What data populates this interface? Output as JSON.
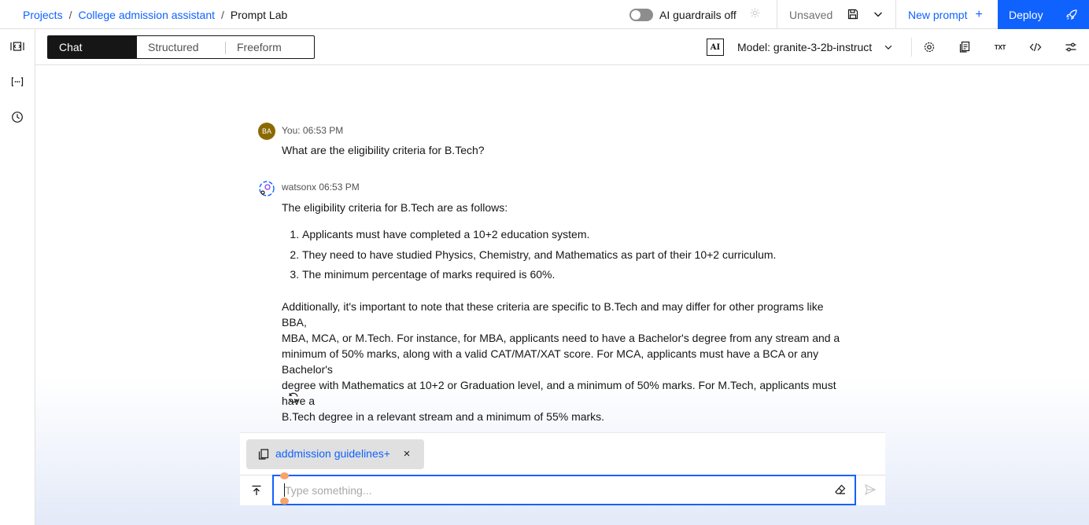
{
  "breadcrumb": {
    "projects": "Projects",
    "sep1": "/",
    "project": "College admission assistant",
    "sep2": "/",
    "current": "Prompt Lab"
  },
  "header": {
    "guardrails_label": "AI guardrails off",
    "guardrails_on": false,
    "unsaved_label": "Unsaved",
    "new_prompt_label": "New prompt",
    "new_prompt_plus": "+",
    "deploy_label": "Deploy"
  },
  "modes": {
    "chat": "Chat",
    "structured": "Structured",
    "freeform": "Freeform",
    "active": "Chat"
  },
  "model": {
    "badge": "AI",
    "label": "Model: granite-3-2b-instruct",
    "toolbar_txt": "TXT"
  },
  "conversation": {
    "user": {
      "avatar_initials": "BA",
      "meta": "You: 06:53 PM",
      "text": "What are the eligibility criteria for B.Tech?"
    },
    "assistant": {
      "meta": "watsonx 06:53 PM",
      "intro": "The eligibility criteria for B.Tech are as follows:",
      "items": [
        "Applicants must have completed a 10+2 education system.",
        "They need to have studied Physics, Chemistry, and Mathematics as part of their 10+2 curriculum.",
        "The minimum percentage of marks required is 60%."
      ],
      "paragraph_lines": [
        "Additionally, it's important to note that these criteria are specific to B.Tech and may differ for other programs like BBA,",
        "MBA, MCA, or M.Tech. For instance, for MBA, applicants need to have a Bachelor's degree from any stream and a",
        "minimum of 50% marks, along with a valid CAT/MAT/XAT score. For MCA, applicants must have a BCA or any Bachelor's",
        "degree with Mathematics at 10+2 or Graduation level, and a minimum of 50% marks. For M.Tech, applicants must have a",
        "B.Tech degree in a relevant stream and a minimum of 55% marks."
      ]
    }
  },
  "composer": {
    "attachment_name": "addmission guidelines+",
    "attachment_close": "×",
    "input_value": "",
    "placeholder": "Type something..."
  },
  "colors": {
    "accent": "#0f62fe",
    "user_avatar": "#8a6a00",
    "active_mode_bg": "#161616"
  },
  "icons": {
    "rail": [
      "side-panel-icon",
      "variables-icon",
      "history-icon"
    ],
    "toolbar": [
      "model-settings-icon",
      "copy-prompt-icon",
      "txt-export-icon",
      "code-icon",
      "parameters-icon"
    ]
  }
}
